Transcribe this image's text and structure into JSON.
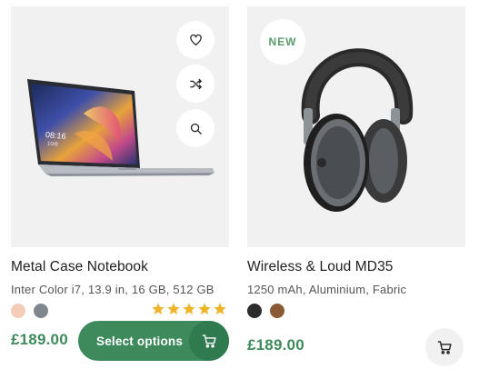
{
  "products": [
    {
      "title": "Metal Case Notebook",
      "specs": "Inter Color i7, 13.9 in, 16 GB, 512 GB",
      "price": "£189.00",
      "swatches": [
        "#f3cdb7",
        "#7f868c"
      ],
      "rating": 5,
      "star_color": "#f0b429",
      "select_label": "Select options",
      "screen_time": "08:16",
      "screen_date": "10/8"
    },
    {
      "title": "Wireless & Loud MD35",
      "specs": "1250 mAh, Aluminium, Fabric",
      "price": "£189.00",
      "swatches": [
        "#2b2b2b",
        "#8a5a34"
      ],
      "badge": "NEW"
    }
  ],
  "colors": {
    "accent": "#3e8a5c",
    "accent_dark": "#2f7a4e",
    "media_bg": "#f1f1f1"
  },
  "icons": [
    "heart-icon",
    "shuffle-icon",
    "search-icon",
    "cart-icon"
  ]
}
